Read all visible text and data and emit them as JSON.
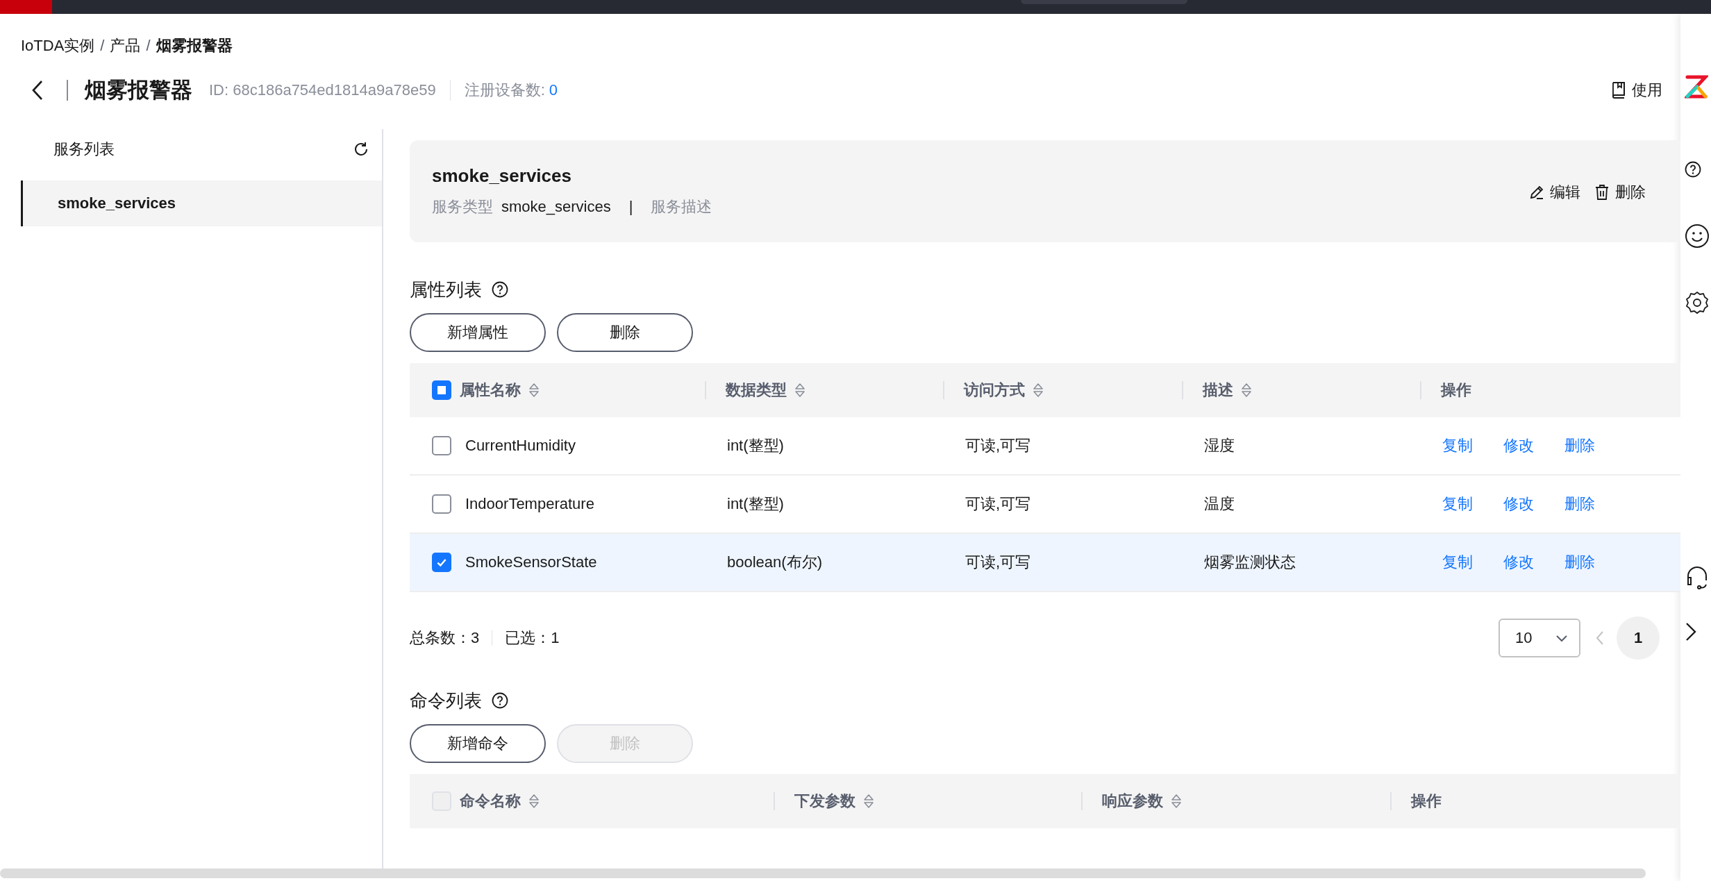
{
  "breadcrumb": [
    {
      "label": "IoTDA实例",
      "current": false
    },
    {
      "label": "产品",
      "separator": "/",
      "current": false
    },
    {
      "label": "烟雾报警器",
      "separator": "/",
      "current": true
    }
  ],
  "header": {
    "title": "烟雾报警器",
    "id_label": "ID: 68c186a754ed1814a9a78e59",
    "device_count_label": "注册设备数:",
    "device_count": "0",
    "guide_link": "使用"
  },
  "sidebar": {
    "title": "服务列表",
    "items": [
      {
        "label": "smoke_services",
        "selected": true
      }
    ]
  },
  "service_card": {
    "title": "smoke_services",
    "type_label": "服务类型",
    "type_value": "smoke_services",
    "separator": "|",
    "description_label": "服务描述",
    "actions": [
      {
        "label": "编辑",
        "kind": "edit"
      },
      {
        "label": "删除",
        "kind": "delete"
      }
    ]
  },
  "properties": {
    "title": "属性列表",
    "buttons": [
      {
        "label": "新增属性",
        "disabled": false
      },
      {
        "label": "删除",
        "disabled": false
      }
    ],
    "select_all": {
      "indeterminate": true,
      "disabled": false
    },
    "columns": [
      {
        "label": "属性名称",
        "sortable": true
      },
      {
        "label": "数据类型",
        "sortable": true
      },
      {
        "label": "访问方式",
        "sortable": true
      },
      {
        "label": "描述",
        "sortable": true
      },
      {
        "label": "操作",
        "sortable": false
      }
    ],
    "rows": [
      {
        "checked": false,
        "cells": [
          "CurrentHumidity",
          "int(整型)",
          "可读,可写",
          "湿度"
        ],
        "actions": [
          "复制",
          "修改",
          "删除"
        ]
      },
      {
        "checked": false,
        "cells": [
          "IndoorTemperature",
          "int(整型)",
          "可读,可写",
          "温度"
        ],
        "actions": [
          "复制",
          "修改",
          "删除"
        ]
      },
      {
        "checked": true,
        "cells": [
          "SmokeSensorState",
          "boolean(布尔)",
          "可读,可写",
          "烟雾监测状态"
        ],
        "actions": [
          "复制",
          "修改",
          "删除"
        ]
      }
    ],
    "total": "总条数：3",
    "selected_count": "已选：1",
    "page_size": "10",
    "pages": [
      {
        "label": "1",
        "selected": true
      }
    ]
  },
  "commands": {
    "title": "命令列表",
    "buttons": [
      {
        "label": "新增命令",
        "disabled": false
      },
      {
        "label": "删除",
        "disabled": true
      }
    ],
    "select_all": {
      "indeterminate": false,
      "disabled": true
    },
    "columns": [
      {
        "label": "命令名称",
        "sortable": true
      },
      {
        "label": "下发参数",
        "sortable": true
      },
      {
        "label": "响应参数",
        "sortable": true
      },
      {
        "label": "操作",
        "sortable": false
      }
    ]
  }
}
